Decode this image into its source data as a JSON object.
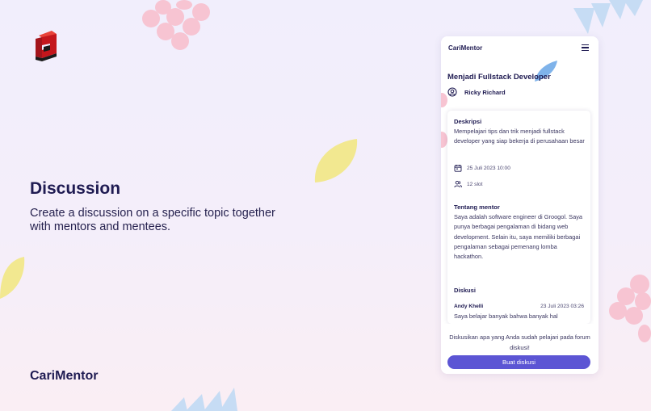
{
  "slide": {
    "title": "Discussion",
    "subtitle": "Create a discussion on a specific topic together with mentors and mentees.",
    "footer_brand": "CariMentor"
  },
  "app": {
    "name": "CariMentor",
    "course_title": "Menjadi Fullstack Developer",
    "mentor_name": "Ricky Richard",
    "sections": {
      "description": {
        "heading": "Deskripsi",
        "text": "Mempelajari tips dan trik menjadi fullstack developer yang siap bekerja di perusahaan besar",
        "date": "25 Juli 2023 10:00",
        "slots": "12 slot"
      },
      "about_mentor": {
        "heading": "Tentang mentor",
        "text": "Saya adalah software engineer di Groogol. Saya punya berbagai pengalaman di bidang web development. Selain itu, saya memiliki berbagai pengalaman sebagai pemenang lomba hackathon."
      },
      "discussion": {
        "heading": "Diskusi",
        "user": "Andy Khelli",
        "date": "23 Juli 2023 03:26",
        "message": "Saya belajar banyak bahwa banyak hal"
      }
    },
    "cta_text": "Diskusikan apa yang Anda sudah pelajari pada forum diskusi!",
    "cta_button": "Buat diskusi"
  },
  "colors": {
    "accent": "#5c55d4",
    "heading": "#1f1b52",
    "decor_pink": "#f7c4d2",
    "decor_yellow": "#f2e890",
    "decor_blue": "#c6dcf4"
  },
  "icons": [
    "menu-icon",
    "user-circle-icon",
    "calendar-icon",
    "users-icon",
    "brand-logo-icon"
  ]
}
